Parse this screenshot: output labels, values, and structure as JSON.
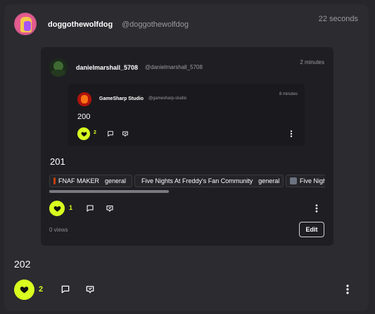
{
  "post": {
    "author_name": "doggothewolfdog",
    "author_handle": "@doggothewolfdog",
    "time": "22 seconds",
    "text": "202",
    "likes": "2"
  },
  "quote": {
    "author_name": "danielmarshall_5708",
    "author_handle": "@danielmarshall_5708",
    "time": "2 minutes",
    "text": "201",
    "likes": "1",
    "views": "0 views",
    "edit_label": "Edit",
    "communities": [
      {
        "name": "FNAF MAKER",
        "tag": "general",
        "color": "#c2410c"
      },
      {
        "name": "Five Nights At Freddy's Fan Community",
        "tag": "general",
        "color": "#b91c1c"
      },
      {
        "name": "Five Nigh",
        "tag": "",
        "color": "#6b7280"
      }
    ]
  },
  "nested_quote": {
    "author_name": "GameSharp Studio",
    "author_handle": "@gamesharp-studio",
    "time": "8 minutes",
    "text": "200",
    "likes": "2"
  },
  "colors": {
    "accent": "#d8ff1f",
    "background": "#26262b",
    "card": "#2b2b30"
  },
  "icons": [
    "heart-icon",
    "comment-icon",
    "quote-icon",
    "more-vertical-icon"
  ]
}
